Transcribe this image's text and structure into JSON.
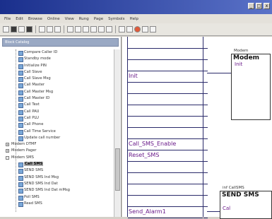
{
  "window": {
    "minimize_glyph": "_",
    "maximize_glyph": "□",
    "close_glyph": "x"
  },
  "menu": {
    "items": [
      "File",
      "Edit",
      "Browse",
      "Online",
      "View",
      "Rung",
      "Page",
      "Symbols",
      "Help"
    ]
  },
  "toolbar": {
    "icons": [
      "new-icon",
      "open-icon",
      "save-icon",
      "print-icon",
      "cut-icon",
      "copy-icon",
      "paste-icon",
      "pointer-icon",
      "contact-icon",
      "coil-icon",
      "zoom-icon",
      "grid-icon",
      "block-icon",
      "run-icon",
      "stop-icon",
      "record-icon",
      "monitor-icon",
      "help-icon"
    ]
  },
  "left_panel": {
    "header": "Block Catalog",
    "items": [
      {
        "label": "Compare Caller ID",
        "level": 2
      },
      {
        "label": "Standby mode",
        "level": 2
      },
      {
        "label": "Initialize PIN",
        "level": 2
      },
      {
        "label": "Call Slave",
        "level": 2
      },
      {
        "label": "Call Slave Msg",
        "level": 2
      },
      {
        "label": "Call Master",
        "level": 2
      },
      {
        "label": "Call Master Msg",
        "level": 2
      },
      {
        "label": "Call Master ID",
        "level": 2
      },
      {
        "label": "Call Text",
        "level": 2
      },
      {
        "label": "Call PAU",
        "level": 2
      },
      {
        "label": "Call PLU",
        "level": 2
      },
      {
        "label": "Call Phone",
        "level": 2
      },
      {
        "label": "Call Time Service",
        "level": 2
      },
      {
        "label": "Update call number",
        "level": 2
      },
      {
        "label": "Modem DTMF",
        "level": 1,
        "expander": "+"
      },
      {
        "label": "Modem Pager",
        "level": 1,
        "expander": "+"
      },
      {
        "label": "Modem SMS",
        "level": 1,
        "expander": "-"
      },
      {
        "label": "Call SMS",
        "level": 2,
        "selected": true
      },
      {
        "label": "SEND SMS",
        "level": 2
      },
      {
        "label": "SEND SMS Ind Msg",
        "level": 2
      },
      {
        "label": "SEND SMS Ind Dat",
        "level": 2
      },
      {
        "label": "SEND SMS Ind Dat mMsg",
        "level": 2
      },
      {
        "label": "Poll SMS",
        "level": 2
      },
      {
        "label": "Read SMS",
        "level": 2
      }
    ]
  },
  "canvas": {
    "rungs": [
      "",
      "",
      "",
      "Init",
      "",
      "",
      "",
      "",
      "",
      "Call_SMS_Enable",
      "Reset_SMS",
      "",
      "",
      "",
      "",
      "Send_Alarm1"
    ],
    "block1": {
      "label": "Modem",
      "title": "Modem",
      "pin": "Init"
    },
    "block2": {
      "label": "inf CallSMS",
      "title": "SEND SMS",
      "pin": "Cal"
    }
  },
  "colors": {
    "title_bar": "#1a2f8c",
    "signal_text": "#6a1a8a",
    "rung_line": "#2a2a6a"
  }
}
